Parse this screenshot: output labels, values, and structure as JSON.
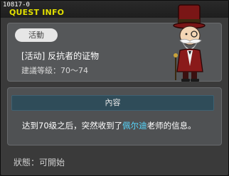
{
  "window": {
    "quest_id": "10817-0",
    "title": "QUEST INFO"
  },
  "quest": {
    "badge": "活動",
    "name": "[活动] 反抗者的证物",
    "level_requirement": "建議等級：70～74"
  },
  "content": {
    "header": "內容",
    "description_before": "达到70级之后，突然收到了",
    "description_highlight": "佩尔迪",
    "description_after": "老师的信息。",
    "highlight_color": "#57d8ff"
  },
  "status": {
    "text": "狀態：可開始"
  },
  "npc": {
    "icon": "npc-professor-top-hat-portrait"
  }
}
